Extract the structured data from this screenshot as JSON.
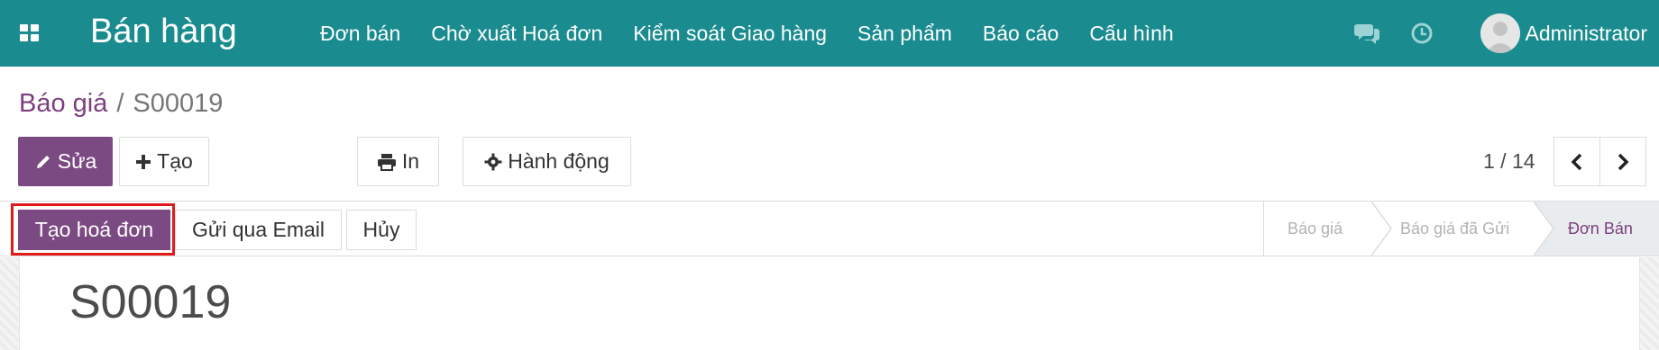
{
  "navbar": {
    "app_title": "Bán hàng",
    "menu": [
      "Đơn bán",
      "Chờ xuất Hoá đơn",
      "Kiểm soát Giao hàng",
      "Sản phẩm",
      "Báo cáo",
      "Cấu hình"
    ],
    "user_name": "Administrator",
    "icons": [
      "apps-grid-icon",
      "chat-icon",
      "clock-icon"
    ]
  },
  "breadcrumb": {
    "parent": "Báo giá",
    "separator": "/",
    "current": "S00019"
  },
  "toolbar": {
    "edit_label": "Sửa",
    "create_label": "Tạo",
    "print_label": "In",
    "action_label": "Hành động"
  },
  "pager": {
    "value": "1 / 14"
  },
  "statusbar": {
    "create_invoice_label": "Tạo hoá đơn",
    "send_email_label": "Gửi qua Email",
    "cancel_label": "Hủy",
    "stages": [
      "Báo giá",
      "Báo giá đã Gửi",
      "Đơn Bán"
    ],
    "active_stage": "Đơn Bán"
  },
  "record": {
    "title": "S00019"
  },
  "colors": {
    "navbar": "#1a8b8f",
    "primary": "#7c4a82",
    "link": "#7c3f7e",
    "highlight": "#e01b1b"
  }
}
